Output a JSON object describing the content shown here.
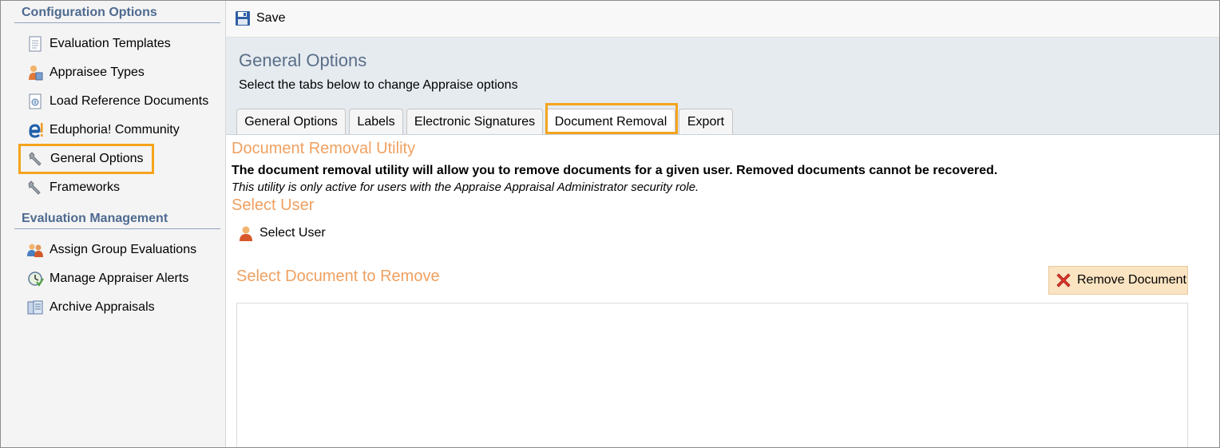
{
  "sidebar": {
    "sections": [
      {
        "title": "Configuration Options",
        "items": [
          {
            "label": "Evaluation Templates",
            "icon": "document-icon"
          },
          {
            "label": "Appraisee Types",
            "icon": "people-icon"
          },
          {
            "label": "Load Reference Documents",
            "icon": "reference-document-icon"
          },
          {
            "label": "Eduphoria! Community",
            "icon": "eduphoria-logo-icon"
          },
          {
            "label": "General Options",
            "icon": "wrench-icon",
            "selected": true
          },
          {
            "label": "Frameworks",
            "icon": "wrench-icon"
          }
        ]
      },
      {
        "title": "Evaluation Management",
        "items": [
          {
            "label": "Assign Group Evaluations",
            "icon": "group-icon"
          },
          {
            "label": "Manage Appraiser Alerts",
            "icon": "alert-clock-icon"
          },
          {
            "label": "Archive Appraisals",
            "icon": "archive-icon"
          }
        ]
      }
    ]
  },
  "toolbar": {
    "save_label": "Save",
    "save_icon": "floppy-disk-icon"
  },
  "header": {
    "title": "General Options",
    "subtitle": "Select the tabs below to change Appraise options"
  },
  "tabs": [
    {
      "label": "General Options"
    },
    {
      "label": "Labels"
    },
    {
      "label": "Electronic Signatures"
    },
    {
      "label": "Document Removal",
      "active": true
    },
    {
      "label": "Export"
    }
  ],
  "content": {
    "utility_title": "Document Removal Utility",
    "description_bold": "The document removal utility will allow you to remove documents for a given user. Removed documents cannot be recovered.",
    "description_italic": "This utility is only active for users with the Appraise Appraisal Administrator security role.",
    "select_user_title": "Select User",
    "select_user_button": "Select User",
    "select_doc_title": "Select Document to Remove",
    "remove_button": "Remove Document"
  },
  "colors": {
    "highlight": "#f4a41c",
    "section_header": "#4e6a90",
    "orange_heading": "#f0a060",
    "header_band": "#e6ebf0",
    "remove_button_bg": "#fbe4c2"
  }
}
